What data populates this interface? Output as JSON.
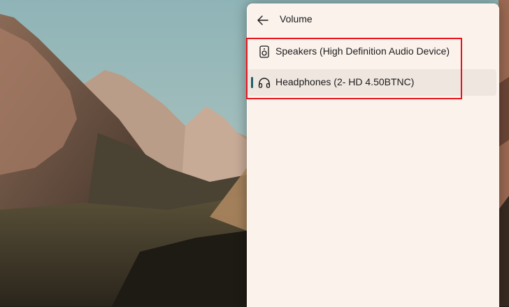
{
  "panel": {
    "title": "Volume",
    "back_icon": "arrow-left-icon",
    "devices": [
      {
        "label": "Speakers (High Definition Audio Device)",
        "icon": "speaker-icon",
        "selected": false
      },
      {
        "label": "Headphones (2- HD 4.50BTNC)",
        "icon": "headphones-icon",
        "selected": true
      }
    ]
  },
  "colors": {
    "panel_bg": "#fbf2ec",
    "selected_bg": "#efe6e0",
    "accent": "#1f5f6a",
    "annotation": "#e8141b"
  }
}
